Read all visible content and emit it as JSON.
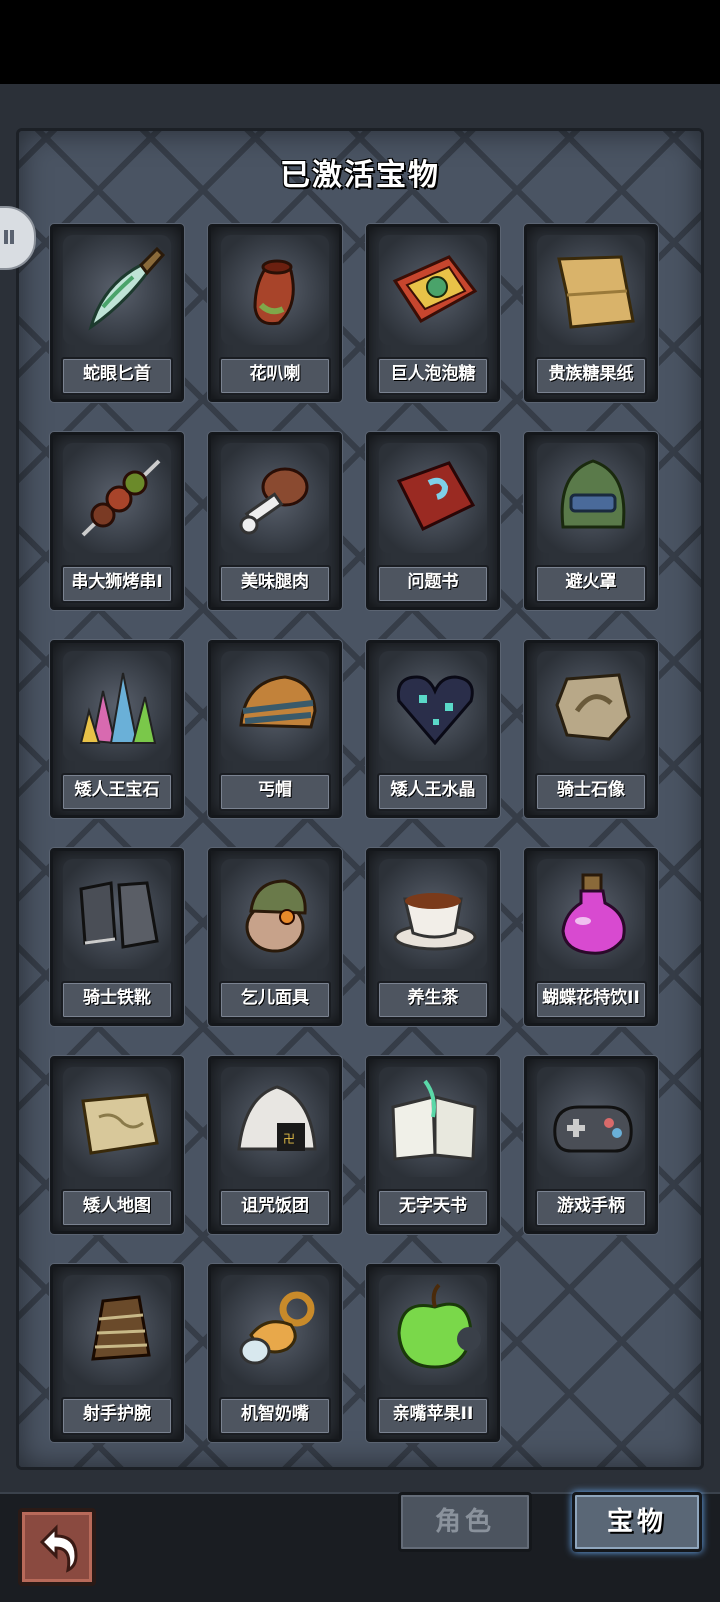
{
  "panel": {
    "title": "已激活宝物"
  },
  "items": [
    {
      "name": "蛇眼匕首",
      "icon": "dagger-icon"
    },
    {
      "name": "花叭喇",
      "icon": "pitcher-plant-icon"
    },
    {
      "name": "巨人泡泡糖",
      "icon": "bubblegum-box-icon"
    },
    {
      "name": "贵族糖果纸",
      "icon": "candy-wrapper-icon"
    },
    {
      "name": "串大狮烤串I",
      "icon": "kebab-skewer-icon"
    },
    {
      "name": "美味腿肉",
      "icon": "meat-leg-icon"
    },
    {
      "name": "问题书",
      "icon": "question-book-icon"
    },
    {
      "name": "避火罩",
      "icon": "fire-helmet-icon"
    },
    {
      "name": "矮人王宝石",
      "icon": "gem-cluster-icon"
    },
    {
      "name": "丐帽",
      "icon": "beanie-hat-icon"
    },
    {
      "name": "矮人王水晶",
      "icon": "crystal-heart-icon"
    },
    {
      "name": "骑士石像",
      "icon": "stone-plaque-icon"
    },
    {
      "name": "骑士铁靴",
      "icon": "iron-boots-icon"
    },
    {
      "name": "乞儿面具",
      "icon": "beggar-mask-icon"
    },
    {
      "name": "养生茶",
      "icon": "tea-cup-icon"
    },
    {
      "name": "蝴蝶花特饮II",
      "icon": "potion-bottle-icon"
    },
    {
      "name": "矮人地图",
      "icon": "map-scroll-icon"
    },
    {
      "name": "诅咒饭团",
      "icon": "rice-ball-icon"
    },
    {
      "name": "无字天书",
      "icon": "blank-book-icon"
    },
    {
      "name": "游戏手柄",
      "icon": "gamepad-icon"
    },
    {
      "name": "射手护腕",
      "icon": "bracer-icon"
    },
    {
      "name": "机智奶嘴",
      "icon": "pacifier-icon"
    },
    {
      "name": "亲嘴苹果II",
      "icon": "bitten-apple-icon"
    }
  ],
  "bottom_bar": {
    "tabs": [
      {
        "label": "角色",
        "active": false
      },
      {
        "label": "宝物",
        "active": true
      }
    ],
    "back_icon": "return-arrow-icon"
  },
  "colors": {
    "panel": "#4a5463",
    "active_tab_glow": "#6fb3ff"
  }
}
